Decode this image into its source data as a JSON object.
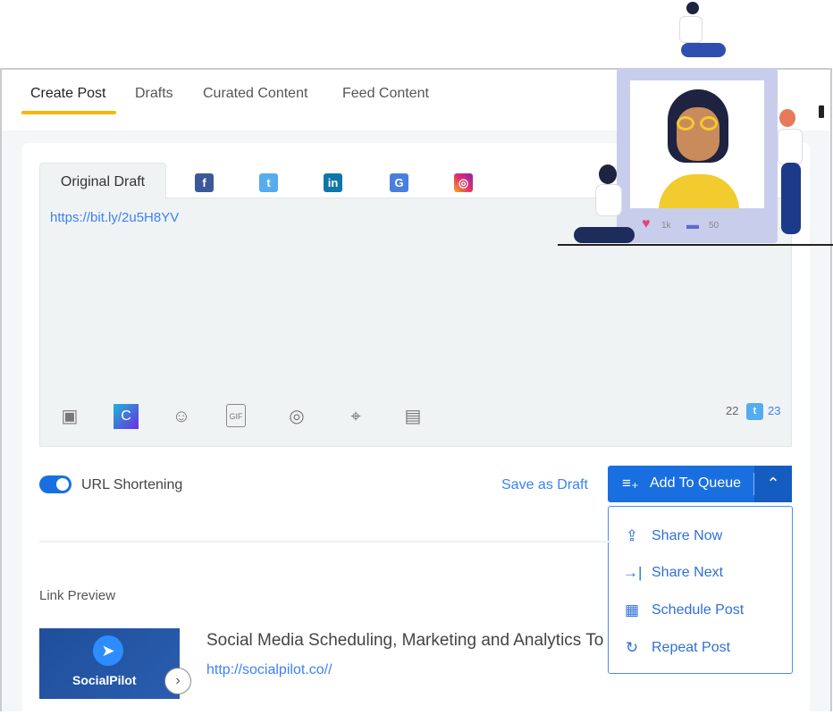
{
  "tabs": [
    {
      "label": "Create Post"
    },
    {
      "label": "Drafts"
    },
    {
      "label": "Curated Content"
    },
    {
      "label": "Feed Content"
    }
  ],
  "editor": {
    "original_tab": "Original Draft",
    "networks": [
      "facebook",
      "twitter",
      "linkedin",
      "google-my-business",
      "instagram"
    ],
    "text": "https://bit.ly/2u5H8YV",
    "count_left": "22",
    "count_right": "23",
    "tools": [
      "media-icon",
      "canva-icon",
      "emoji-icon",
      "gif-icon",
      "target-icon",
      "location-icon",
      "comment-icon"
    ],
    "canva_label": "C",
    "gif_label": "GIF"
  },
  "url_shortening": {
    "label": "URL Shortening",
    "enabled": true
  },
  "actions": {
    "save_draft": "Save as Draft",
    "add_to_queue": "Add To Queue"
  },
  "menu": [
    {
      "label": "Share Now"
    },
    {
      "label": "Share Next"
    },
    {
      "label": "Schedule Post"
    },
    {
      "label": "Repeat Post"
    }
  ],
  "preview": {
    "heading": "Link Preview",
    "title": "Social Media Scheduling, Marketing and Analytics To",
    "url": "http://socialpilot.co//",
    "brand": "SocialPilot"
  },
  "illustration": {
    "likes": "1k",
    "comments": "50"
  },
  "colors": {
    "accent": "#1a6fe0",
    "tab_underline": "#f5b800"
  }
}
